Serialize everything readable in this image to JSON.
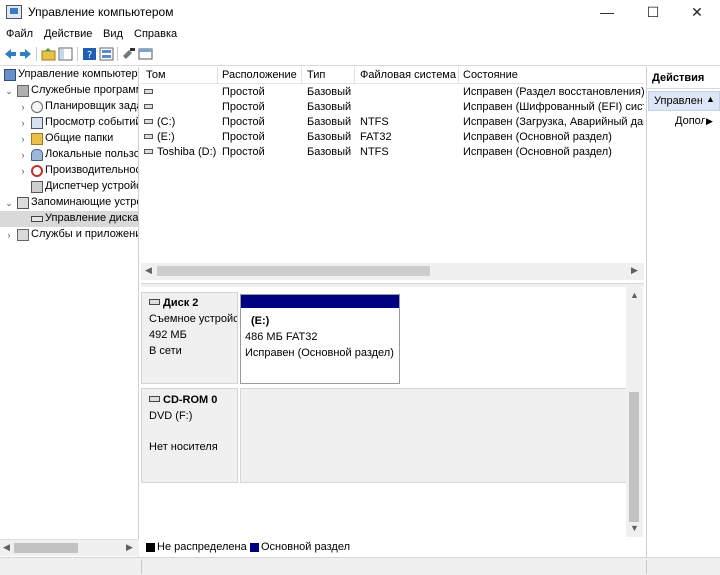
{
  "window": {
    "title": "Управление компьютером",
    "minimize_glyph": "—",
    "maximize_glyph": "☐",
    "close_glyph": "✕"
  },
  "menu": [
    "Файл",
    "Действие",
    "Вид",
    "Справка"
  ],
  "toolbar": {
    "icons": [
      "back-arrow-icon",
      "forward-arrow-icon",
      "up-folder-icon",
      "console-tree-icon",
      "help-icon",
      "properties-icon",
      "connect-icon",
      "console-icon"
    ]
  },
  "tree": {
    "items": [
      {
        "label": "Управление компьютером (локальным)",
        "level": 0,
        "twisty": "",
        "icon": "computer-icon"
      },
      {
        "label": "Служебные программы",
        "level": 1,
        "twisty": "⌄",
        "icon": "tools-icon"
      },
      {
        "label": "Планировщик заданий",
        "level": 2,
        "twisty": "›",
        "icon": "clock-icon"
      },
      {
        "label": "Просмотр событий",
        "level": 2,
        "twisty": "›",
        "icon": "event-viewer-icon"
      },
      {
        "label": "Общие папки",
        "level": 2,
        "twisty": "›",
        "icon": "shared-folder-icon"
      },
      {
        "label": "Локальные пользователи",
        "level": 2,
        "twisty": "›",
        "icon": "users-icon"
      },
      {
        "label": "Производительность",
        "level": 2,
        "twisty": "›",
        "icon": "performance-icon"
      },
      {
        "label": "Диспетчер устройств",
        "level": 2,
        "twisty": "",
        "icon": "device-manager-icon"
      },
      {
        "label": "Запоминающие устройства",
        "level": 1,
        "twisty": "⌄",
        "icon": "storage-icon"
      },
      {
        "label": "Управление дисками",
        "level": 2,
        "twisty": "",
        "icon": "disk-management-icon",
        "selected": true
      },
      {
        "label": "Службы и приложения",
        "level": 1,
        "twisty": "›",
        "icon": "services-icon"
      }
    ]
  },
  "volumes": {
    "columns": [
      "Том",
      "Расположение",
      "Тип",
      "Файловая система",
      "Состояние"
    ],
    "rows": [
      {
        "name": "",
        "layout": "Простой",
        "type": "Базовый",
        "fs": "",
        "status": "Исправен (Раздел восстановления)"
      },
      {
        "name": "",
        "layout": "Простой",
        "type": "Базовый",
        "fs": "",
        "status": "Исправен (Шифрованный (EFI) системный раздел)"
      },
      {
        "name": "(C:)",
        "layout": "Простой",
        "type": "Базовый",
        "fs": "NTFS",
        "status": "Исправен (Загрузка, Аварийный дамп памяти, Основной раздел)"
      },
      {
        "name": "(E:)",
        "layout": "Простой",
        "type": "Базовый",
        "fs": "FAT32",
        "status": "Исправен (Основной раздел)"
      },
      {
        "name": "Toshiba (D:)",
        "layout": "Простой",
        "type": "Базовый",
        "fs": "NTFS",
        "status": "Исправен (Основной раздел)"
      }
    ]
  },
  "disks": [
    {
      "name": "Диск 2",
      "kind": "Съемное устройство",
      "size": "492 МБ",
      "state": "В сети",
      "partition": {
        "name": "(E:)",
        "details": "486 МБ FAT32",
        "status": "Исправен (Основной раздел)"
      }
    },
    {
      "name": "CD-ROM 0",
      "kind": "DVD (F:)",
      "size": "",
      "state": "Нет носителя"
    }
  ],
  "legend": [
    {
      "label": "Не распределена",
      "color": "#000000"
    },
    {
      "label": "Основной раздел",
      "color": "#000080"
    }
  ],
  "actions": {
    "title": "Действия",
    "section": "Управление дисками",
    "more": "Дополнительные действия"
  }
}
